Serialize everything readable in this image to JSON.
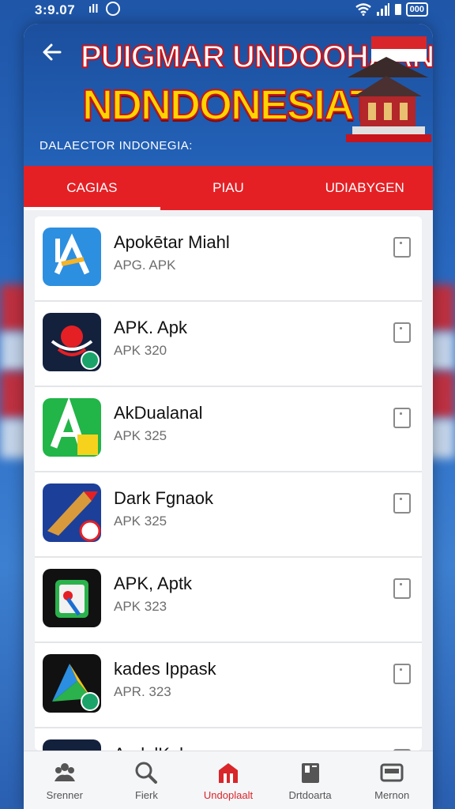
{
  "status": {
    "time": "3:9.07",
    "battery": "000"
  },
  "header": {
    "hero_line1": "PUIGMAR UNDOOHAAN",
    "hero_line2": "NDNDONESIAT.",
    "subtitle": "DALAECTOR INDONEGIA:"
  },
  "tabs": [
    {
      "label": "CAGIAS",
      "active": true
    },
    {
      "label": "PIAU",
      "active": false
    },
    {
      "label": "UDIABYGEN",
      "active": false
    }
  ],
  "apps": [
    {
      "name": "Apokētar Miahl",
      "sub": "APG. APK",
      "icon": "blue-a-app-icon"
    },
    {
      "name": "APK. Apk",
      "sub": "APK 320",
      "icon": "red-emblem-app-icon"
    },
    {
      "name": "AkDualanal",
      "sub": "APK 325",
      "icon": "green-a-app-icon"
    },
    {
      "name": "Dark Fgnaok",
      "sub": "APK 325",
      "icon": "pencil-app-icon"
    },
    {
      "name": "APK, Aptk",
      "sub": "APK 323",
      "icon": "green-pin-app-icon"
    },
    {
      "name": "kades Ippask",
      "sub": "APR. 323",
      "icon": "colorful-a-app-icon"
    },
    {
      "name": "AprlalKak",
      "sub": "",
      "icon": "gold-crown-app-icon"
    }
  ],
  "bottom_nav": [
    {
      "label": "Srenner",
      "icon": "people-icon",
      "active": false
    },
    {
      "label": "Fierk",
      "icon": "search-icon",
      "active": false
    },
    {
      "label": "Undoplaalt",
      "icon": "home-icon",
      "active": true
    },
    {
      "label": "Drtdoarta",
      "icon": "document-icon",
      "active": false
    },
    {
      "label": "Mernon",
      "icon": "card-icon",
      "active": false
    }
  ],
  "colors": {
    "brand_blue": "#2362b8",
    "accent_red": "#e42025",
    "title_yellow": "#ffd400"
  }
}
